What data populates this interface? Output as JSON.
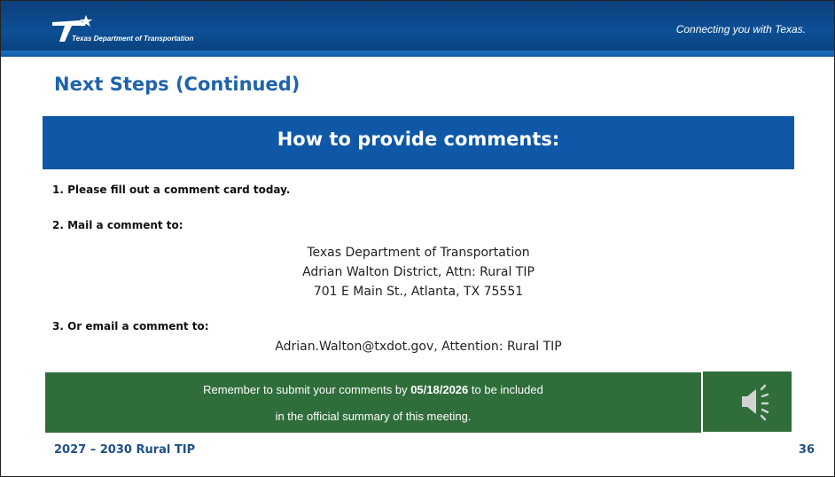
{
  "header": {
    "logo_text": "Texas Department of Transportation",
    "tagline": "Connecting you with Texas."
  },
  "title": "Next Steps (Continued)",
  "banner": "How to provide comments:",
  "steps": [
    {
      "number": "1.",
      "text": "Please fill out a comment card today."
    },
    {
      "number": "2.",
      "text": "Mail a comment to:"
    },
    {
      "number": "3.",
      "text": "Or email a comment to:"
    }
  ],
  "mail_address": [
    "Texas Department of Transportation",
    "Adrian Walton District, Attn: Rural TIP",
    "701 E Main St., Atlanta, TX 75551"
  ],
  "email_line": "Adrian.Walton@txdot.gov, Attention: Rural TIP",
  "reminder": {
    "before": "Remember to submit your comments by ",
    "date": "05/18/2026",
    "after": " to be included",
    "line2": "in the official summary of this meeting."
  },
  "footer": {
    "program": "2027 – 2030  Rural TIP",
    "page_number": "36"
  },
  "colors": {
    "header_blue": "#0b4f95",
    "title_blue": "#1f63ad",
    "banner_blue": "#0f58a8",
    "reminder_green": "#2f6d3a"
  },
  "icons": {
    "logo": "txdot-star-logo-icon",
    "audio": "speaker-icon"
  }
}
